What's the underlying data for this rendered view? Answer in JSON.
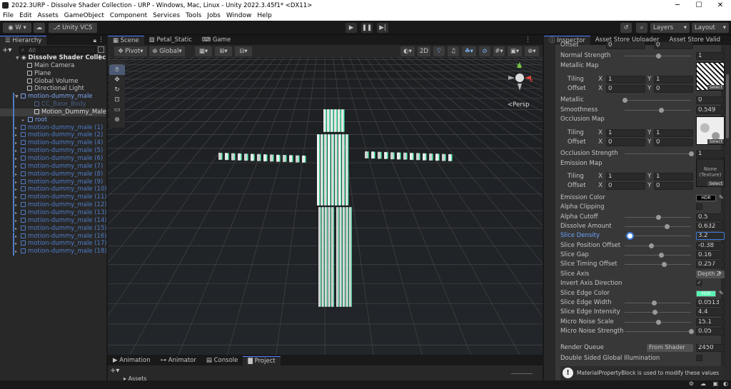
{
  "window": {
    "title": "2022.3URP - Dissolve Shader Collection - URP - Windows, Mac, Linux - Unity 2022.3.45f1* <DX11>",
    "min": "─",
    "max": "☐",
    "close": "✕"
  },
  "menu": [
    "File",
    "Edit",
    "Assets",
    "GameObject",
    "Component",
    "Services",
    "Tools",
    "Jobs",
    "Window",
    "Help"
  ],
  "toolbar": {
    "account": "W",
    "vcs": "Unity VCS",
    "layers": "Layers",
    "layout": "Layout"
  },
  "hierarchy": {
    "tab": "Hierarchy",
    "search_placeholder": "All",
    "scene": "Dissolve Shader Collec",
    "rows": [
      {
        "label": "Main Camera"
      },
      {
        "label": "Plane"
      },
      {
        "label": "Global Volume"
      },
      {
        "label": "Directional Light"
      },
      {
        "label": "motion-dummy_male"
      },
      {
        "label": "CC_Base_Body"
      },
      {
        "label": "Motion_Dummy_Male"
      },
      {
        "label": "root"
      },
      {
        "label": "motion-dummy_male (1)"
      },
      {
        "label": "motion-dummy_male (2)"
      },
      {
        "label": "motion-dummy_male (4)"
      },
      {
        "label": "motion-dummy_male (5)"
      },
      {
        "label": "motion-dummy_male (6)"
      },
      {
        "label": "motion-dummy_male (7)"
      },
      {
        "label": "motion-dummy_male (8)"
      },
      {
        "label": "motion-dummy_male (9)"
      },
      {
        "label": "motion-dummy_male (10)"
      },
      {
        "label": "motion-dummy_male (11)"
      },
      {
        "label": "motion-dummy_male (12)"
      },
      {
        "label": "motion-dummy_male (13)"
      },
      {
        "label": "motion-dummy_male (14)"
      },
      {
        "label": "motion-dummy_male (15)"
      },
      {
        "label": "motion-dummy_male (16)"
      },
      {
        "label": "motion-dummy_male (17)"
      },
      {
        "label": "motion-dummy_male (18)"
      }
    ]
  },
  "scene_tabs": {
    "scene": "Scene",
    "petal": "Petal_Static",
    "game": "Game"
  },
  "scene_toolbar": {
    "pivot": "Pivot",
    "global": "Global",
    "mode2d": "2D"
  },
  "gizmo": {
    "persp": "<Persp",
    "y": "y",
    "x": "x",
    "z": "z"
  },
  "bottom": {
    "animation": "Animation",
    "animator": "Animator",
    "console": "Console",
    "project": "Project",
    "assets": "Assets"
  },
  "inspector": {
    "tabs": [
      "Inspector",
      "Asset Store Uploader",
      "Asset Store Valid"
    ],
    "top_offset": {
      "label": "Offset",
      "x": "0",
      "y": "0",
      "sel": "Select"
    },
    "normal_strength": {
      "label": "Normal Strength",
      "value": "1"
    },
    "metallic_map": {
      "label": "Metallic Map",
      "tiling": "Tiling",
      "offset": "Offset",
      "tx": "1",
      "ty": "1",
      "ox": "0",
      "oy": "0",
      "sel": "Select"
    },
    "metallic": {
      "label": "Metallic",
      "value": "0"
    },
    "smoothness": {
      "label": "Smoothness",
      "value": "0.549"
    },
    "occlusion_map": {
      "label": "Occlusion Map",
      "tiling": "Tiling",
      "offset": "Offset",
      "tx": "1",
      "ty": "1",
      "ox": "0",
      "oy": "0",
      "sel": "Select"
    },
    "occlusion_strength": {
      "label": "Occlusion Strength",
      "value": "1"
    },
    "emission_map": {
      "label": "Emission Map",
      "tiling": "Tiling",
      "offset": "Offset",
      "tx": "1",
      "ty": "1",
      "ox": "0",
      "oy": "0",
      "none": "None (Texture)",
      "sel": "Select"
    },
    "props": [
      {
        "label": "Emission Color",
        "value": "HDR"
      },
      {
        "label": "Alpha Clipping",
        "value": ""
      },
      {
        "label": "Alpha Cutoff",
        "value": "0.5",
        "slider": 0.5
      },
      {
        "label": "Dissolve Amount",
        "value": "0.632",
        "slider": 0.632
      },
      {
        "label": "Slice Density",
        "value": "3.2",
        "slider": 0.08
      },
      {
        "label": "Slice Position Offset",
        "value": "-0.38",
        "slider": 0.4
      },
      {
        "label": "Slice Gap",
        "value": "0.16",
        "slider": 0.55
      },
      {
        "label": "Slice Timing Offset",
        "value": "0.257",
        "slider": 0.59
      },
      {
        "label": "Slice Axis",
        "value": "Depth Z"
      },
      {
        "label": "Invert Axis Direction",
        "value": "✓"
      },
      {
        "label": "Slice Edge Color",
        "value": "HDR"
      },
      {
        "label": "Slice Edge Width",
        "value": "0.0513",
        "slider": 0.44
      },
      {
        "label": "Slice Edge Intensity",
        "value": "4.4",
        "slider": 0.45
      },
      {
        "label": "Micro Noise Scale",
        "value": "15.1",
        "slider": 0.5
      },
      {
        "label": "Micro Noise Strength",
        "value": "0.05",
        "slider": 1.0
      }
    ],
    "render_queue": {
      "label": "Render Queue",
      "mode": "From Shader",
      "value": "2450"
    },
    "double_sided": {
      "label": "Double Sided Global Illumination"
    },
    "info": "MaterialPropertyBlock is used to modify these values"
  },
  "colors": {
    "accent": "#4c7eff",
    "edge": "#59f5b4",
    "prefab_blue": "#5d8bd8"
  }
}
